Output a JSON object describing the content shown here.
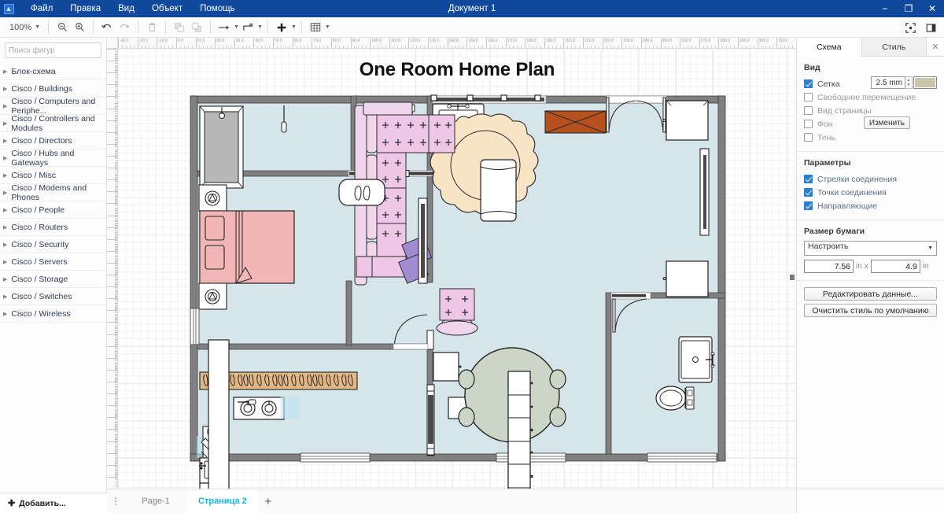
{
  "titlebar": {
    "logo": "app-logo",
    "document_title": "Документ 1",
    "menu": [
      "Файл",
      "Правка",
      "Вид",
      "Объект",
      "Помощь"
    ],
    "window_controls": {
      "minimize": "−",
      "maximize": "❐",
      "close": "✕"
    }
  },
  "toolbar": {
    "zoom_level": "100%",
    "buttons": [
      "zoom-out-icon",
      "zoom-in-icon",
      "undo-icon",
      "redo-icon",
      "delete-icon",
      "to-front-icon",
      "to-back-icon",
      "connection-icon",
      "waypoints-icon",
      "insert-icon",
      "table-icon"
    ],
    "right_buttons": [
      "fullscreen-icon",
      "format-panel-icon"
    ]
  },
  "sidebar": {
    "search": {
      "placeholder": "Поиск фигур",
      "value": ""
    },
    "items": [
      {
        "label": "Блок-схема"
      },
      {
        "label": "Cisco / Buildings"
      },
      {
        "label": "Cisco / Computers and Periphe..."
      },
      {
        "label": "Cisco / Controllers and Modules"
      },
      {
        "label": "Cisco / Directors"
      },
      {
        "label": "Cisco / Hubs and Gateways"
      },
      {
        "label": "Cisco / Misc"
      },
      {
        "label": "Cisco / Modems and Phones"
      },
      {
        "label": "Cisco / People"
      },
      {
        "label": "Cisco / Routers"
      },
      {
        "label": "Cisco / Security"
      },
      {
        "label": "Cisco / Servers"
      },
      {
        "label": "Cisco / Storage"
      },
      {
        "label": "Cisco / Switches"
      },
      {
        "label": "Cisco / Wireless"
      }
    ],
    "add_label": "Добавить..."
  },
  "canvas": {
    "plan_title": "One Room Home Plan",
    "ruler_h_start": -30,
    "ruler_h_end": 310,
    "ruler_h_step": 10,
    "ruler_v_start": -30,
    "ruler_v_end": 330,
    "ruler_v_step": 10,
    "colors": {
      "wall": "#808080",
      "floor": "#d5e5ea",
      "bed": "#f2b6b6",
      "sofa": "#ecc9e3",
      "rug": "#fae4c6",
      "counter": "#e3b887",
      "door_brown": "#b7501f",
      "table": "#ccd6c6",
      "pillow_purple": "#9f8cd1"
    }
  },
  "right_panel": {
    "tabs": [
      {
        "label": "Схема",
        "active": true
      },
      {
        "label": "Стиль",
        "active": false
      }
    ],
    "close_icon": "✕",
    "view_section": {
      "title": "Вид",
      "grid": {
        "label": "Сетка",
        "checked": true,
        "size_value": "2.5 mm",
        "color": "#c9c6ac"
      },
      "free_move": {
        "label": "Свободное перемещение",
        "checked": false
      },
      "page_view": {
        "label": "Вид страницы",
        "checked": false
      },
      "background": {
        "label": "Фон",
        "checked": false,
        "button": "Изменить"
      },
      "shadow": {
        "label": "Тень",
        "checked": false
      }
    },
    "options_section": {
      "title": "Параметры",
      "items": [
        {
          "label": "Стрелки соединения",
          "checked": true
        },
        {
          "label": "Точки соединения",
          "checked": true
        },
        {
          "label": "Направляющие",
          "checked": true
        }
      ]
    },
    "paper_section": {
      "title": "Размер бумаги",
      "selected": "Настроить",
      "options": [
        "Настроить"
      ],
      "width": "7.56",
      "height": "4.9",
      "unit": "in",
      "separator": "x"
    },
    "actions": [
      "Редактировать данные...",
      "Очистить стиль по умолчанию"
    ]
  },
  "bottom": {
    "tabs": [
      {
        "label": "Page-1",
        "active": false
      },
      {
        "label": "Страница 2",
        "active": true
      }
    ],
    "add_tab_icon": "+",
    "menu_icon": "⋮"
  }
}
